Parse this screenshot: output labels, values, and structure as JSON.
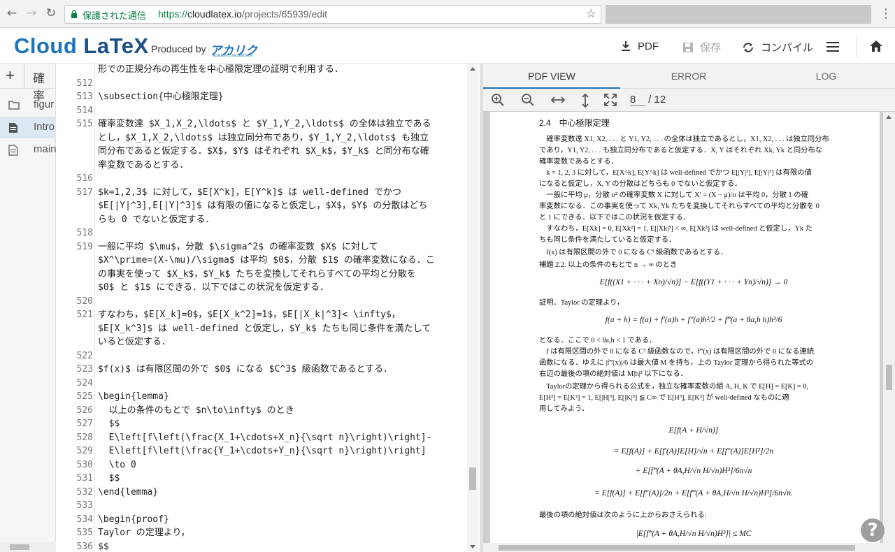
{
  "browser": {
    "secure_label": "保護された通信",
    "url_scheme": "https://",
    "url_host": "cloudlatex.io",
    "url_path": "/projects/65939/edit"
  },
  "header": {
    "logo_cloud": "Cloud ",
    "logo_latex": "LaTeX",
    "produced_by": "Produced by",
    "brand_name": "アカリク",
    "brand_sub": "academic recruitment",
    "pdf_label": "PDF",
    "save_label": "保存",
    "compile_label": "コンパイル"
  },
  "sidebar": {
    "title": "確率",
    "items": [
      {
        "label": "figur",
        "icon": "folder-icon"
      },
      {
        "label": "Intro",
        "icon": "file-icon"
      },
      {
        "label": "main",
        "icon": "file-icon"
      }
    ]
  },
  "editor": {
    "lines": [
      {
        "num": "",
        "text": "形での正規分布の再生性を中心極限定理の証明で利用する．"
      },
      {
        "num": "512",
        "text": ""
      },
      {
        "num": "513",
        "text": "\\subsection{中心極限定理}"
      },
      {
        "num": "514",
        "text": ""
      },
      {
        "num": "515",
        "text": "確率変数達 $X_1,X_2,\\ldots$ と $Y_1,Y_2,\\ldots$ の全体は独立である"
      },
      {
        "num": "",
        "text": "とし，$X_1,X_2,\\ldots$ は独立同分布であり，$Y_1,Y_2,\\ldots$ も独立"
      },
      {
        "num": "",
        "text": "同分布であると仮定する．$X$，$Y$ はそれぞれ $X_k$，$Y_k$ と同分布な確"
      },
      {
        "num": "",
        "text": "率変数であるとする．"
      },
      {
        "num": "516",
        "text": ""
      },
      {
        "num": "517",
        "text": "$k=1,2,3$ に対して，$E[X^k]，E[Y^k]$ は well-defined でかつ"
      },
      {
        "num": "",
        "text": "$E[|Y|^3],E[|Y|^3]$ は有限の値になると仮定し，$X$，$Y$ の分散はどち"
      },
      {
        "num": "",
        "text": "らも 0 でないと仮定する．"
      },
      {
        "num": "518",
        "text": ""
      },
      {
        "num": "519",
        "text": "一般に平均 $\\mu$，分散 $\\sigma^2$ の確率変数 $X$ に対して"
      },
      {
        "num": "",
        "text": "$X^\\prime=(X-\\mu)/\\sigma$ は平均 $0$，分散 $1$ の確率変数になる．こ"
      },
      {
        "num": "",
        "text": "の事実を使って $X_k$，$Y_k$ たちを変換してそれらすべての平均と分散を"
      },
      {
        "num": "",
        "text": "$0$ と $1$ にできる．以下ではこの状況を仮定する．"
      },
      {
        "num": "520",
        "text": ""
      },
      {
        "num": "521",
        "text": "すなわち，$E[X_k]=0$，$E[X_k^2]=1$，$E[|X_k|^3]< \\infty$，"
      },
      {
        "num": "",
        "text": "$E[X_k^3]$ は well-defined と仮定し，$Y_k$ たちも同じ条件を満たして"
      },
      {
        "num": "",
        "text": "いると仮定する．"
      },
      {
        "num": "522",
        "text": ""
      },
      {
        "num": "523",
        "text": "$f(x)$ は有限区間の外で $0$ になる $C^3$ 級函数であるとする．"
      },
      {
        "num": "524",
        "text": ""
      },
      {
        "num": "525",
        "text": "\\begin{lemma}"
      },
      {
        "num": "526",
        "text": "  以上の条件のもとで $n\\to\\infty$ のとき"
      },
      {
        "num": "527",
        "text": "  $$"
      },
      {
        "num": "528",
        "text": "  E\\left[f\\left(\\frac{X_1+\\cdots+X_n}{\\sqrt n}\\right)\\right]-"
      },
      {
        "num": "529",
        "text": "  E\\left[f\\left(\\frac{Y_1+\\cdots+Y_n}{\\sqrt n}\\right)\\right]"
      },
      {
        "num": "530",
        "text": "  \\to 0"
      },
      {
        "num": "531",
        "text": "  $$"
      },
      {
        "num": "532",
        "text": "\\end{lemma}"
      },
      {
        "num": "533",
        "text": ""
      },
      {
        "num": "534",
        "text": "\\begin{proof}"
      },
      {
        "num": "535",
        "text": "Taylor の定理より，"
      },
      {
        "num": "536",
        "text": "$$"
      }
    ]
  },
  "pdf": {
    "tabs": [
      "PDF VIEW",
      "ERROR",
      "LOG"
    ],
    "page_current": "8",
    "page_total": "/ 12",
    "lines": [
      {
        "cls": "h",
        "text": "2.4　中心極限定理"
      },
      {
        "cls": "",
        "text": "　確率変数達 X1, X2, . . . と Y1, Y2, . . . の全体は独立であるとし，X1, X2, . . . は独立同分布"
      },
      {
        "cls": "",
        "text": "であり，Y1, Y2, . . . も独立同分布であると仮定する．X, Y はそれぞれ Xk, Yk と同分布な"
      },
      {
        "cls": "",
        "text": "確率変数であるとする．"
      },
      {
        "cls": "",
        "text": "　k = 1, 2, 3 に対して，E[X^k], E[Y^k] は well-defined でかつ E[|Y|³], E[|Y|³] は有限の値"
      },
      {
        "cls": "",
        "text": "になると仮定し，X, Y の分散はどちらも 0 でないと仮定する．"
      },
      {
        "cls": "",
        "text": "　一般に平均 μ，分散 σ² の確率変数 X に対して X′ = (X − μ)/σ は平均 0，分散 1 の確"
      },
      {
        "cls": "",
        "text": "率変数になる．この事実を使って Xk, Yk たちを変換してそれらすべての平均と分散を 0"
      },
      {
        "cls": "",
        "text": "と 1 にできる．以下ではこの状況を仮定する．"
      },
      {
        "cls": "",
        "text": "　すなわち，E[Xk] = 0, E[Xk²] = 1, E[|Xk|³] < ∞, E[Xk³] は well-defined と仮定し，Yk た"
      },
      {
        "cls": "",
        "text": "ちも同じ条件を満たしていると仮定する．"
      },
      {
        "cls": "",
        "text": "　f(x) は有限区間の外で 0 になる C³ 級函数であるとする．"
      },
      {
        "cls": "",
        "text": "補題 2.2. 以上の条件のもとで n → ∞ のとき"
      },
      {
        "cls": "eq",
        "text": "E[f((X1 + · · · + Xn)/√n)] − E[f((Y1 + · · · + Yn)/√n)] → 0"
      },
      {
        "cls": "",
        "text": "証明．Taylor の定理より，"
      },
      {
        "cls": "eq",
        "text": "f(a + h) = f(a) + f′(a)h + f″(a)h²/2 + f‴(a + θa,h h)h³/6"
      },
      {
        "cls": "",
        "text": "となる．ここで 0 < θa,h < 1 である．"
      },
      {
        "cls": "",
        "text": "　f は有限区間の外で 0 になる C³ 級函数なので，f‴(x) は有限区間の外で 0 になる連続"
      },
      {
        "cls": "",
        "text": "函数になる．ゆえに |f‴(x)|/6 は最大値 M を持ち，上の Taylor 定理から得られた等式の"
      },
      {
        "cls": "",
        "text": "右辺の最後の項の絶対値は M|h|³ 以下になる．"
      },
      {
        "cls": "",
        "text": "　Taylorの定理から得られる公式を，独立な確率変数の組 A, H, K で E[H] = E[K] = 0,"
      },
      {
        "cls": "",
        "text": "E[H²] = E[K²] = 1, E[|H|³], E[|K|³] ≦ C∞ で E[H³], E[K³] が well-defined なものに適"
      },
      {
        "cls": "",
        "text": "用してみよう．"
      },
      {
        "cls": "eq",
        "text": "E[f(A + H/√n)]"
      },
      {
        "cls": "eq",
        "text": "= E[f(A)] + E[f′(A)]E[H]/√n + E[f″(A)]E[H²]/2n"
      },
      {
        "cls": "eq",
        "text": "+ E[f‴(A + θA,H/√n H/√n)H³]/6n√n"
      },
      {
        "cls": "eq",
        "text": "= E[f(A)] + E[f″(A)]/2n + E[f‴(A + θA,H/√n H/√n)H³]/6n√n."
      },
      {
        "cls": "",
        "text": "最後の項の絶対値は次のように上からおさえられる:"
      },
      {
        "cls": "eq",
        "text": "|E[f‴(A + θA,H/√n H/√n)H³]| ≤ MC"
      }
    ]
  },
  "help_label": "?"
}
